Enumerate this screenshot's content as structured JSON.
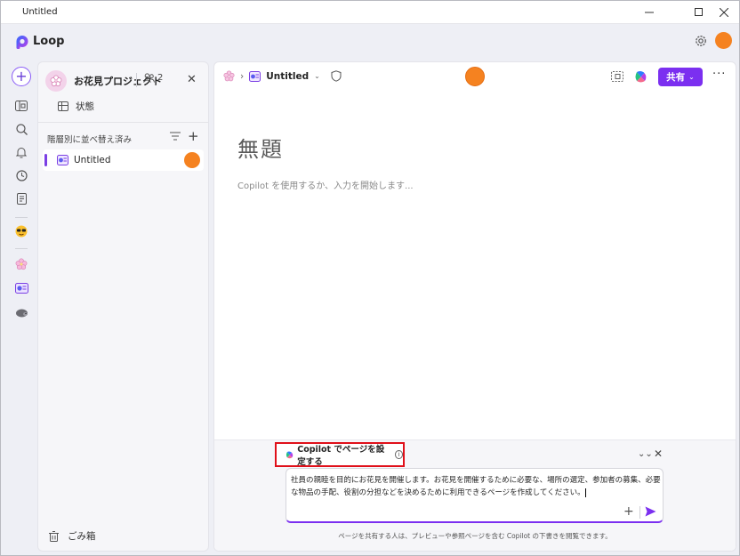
{
  "window": {
    "title": "Untitled",
    "controls": [
      "minimize-icon",
      "maximize-icon",
      "close-icon"
    ]
  },
  "app": {
    "name": "Loop",
    "accent": "#7b2ff0",
    "avatar_color": "#f58220"
  },
  "rail": {
    "items": [
      "new-plus-icon",
      "home-icon",
      "search-icon",
      "bell-icon",
      "clock-icon",
      "notes-icon",
      "sunglasses-emoji-icon",
      "blossom-workspace-icon",
      "loop-page-icon",
      "hedgehog-icon"
    ]
  },
  "sidebar": {
    "workspace_name": "お花見プロジェクト",
    "member_count": "2",
    "status_label": "状態",
    "sort_label": "階層別に並べ替え済み",
    "pages": [
      {
        "label": "Untitled",
        "selected": true
      }
    ],
    "trash_label": "ごみ箱"
  },
  "main": {
    "breadcrumb_title": "Untitled",
    "share_label": "共有",
    "more_label": "···",
    "doc_title": "無題",
    "doc_placeholder": "Copilot を使用するか、入力を開始します..."
  },
  "copilot": {
    "header": "Copilot でページを設定する",
    "prompt": "社員の親睦を目的にお花見を開催します。お花見を開催するために必要な、場所の選定、参加者の募集、必要な物品の手配、役割の分担などを決めるために利用できるページを作成してください。",
    "footer": "ページを共有する人は、プレビューや参照ページを含む Copilot の下書きを閲覧できます。"
  }
}
